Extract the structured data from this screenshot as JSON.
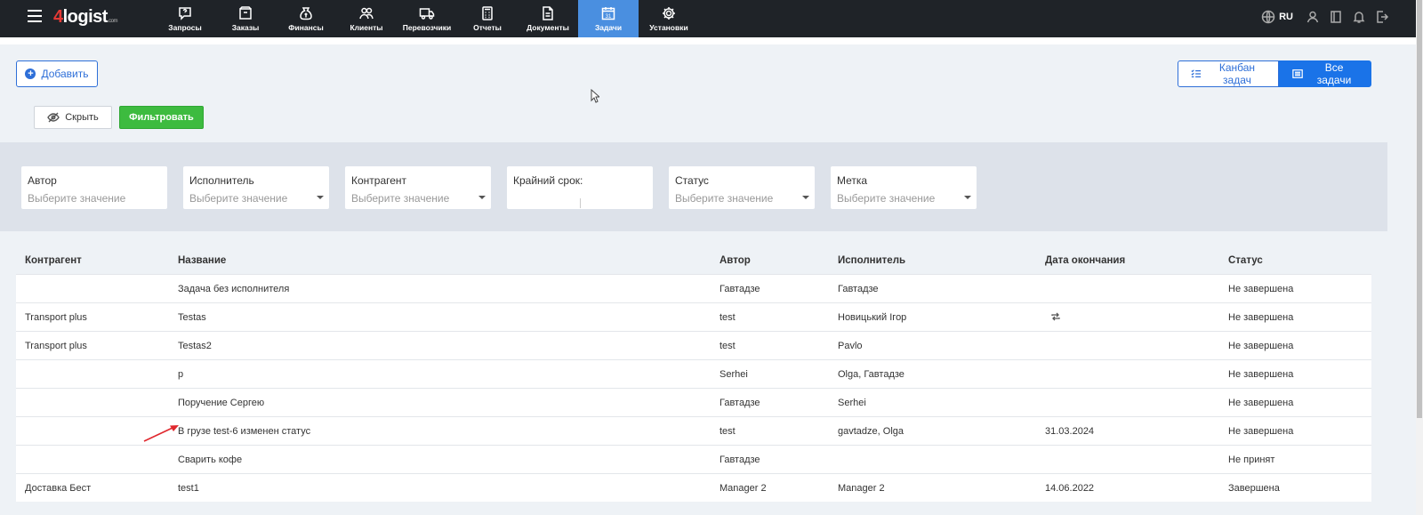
{
  "app": {
    "logo_main": "logist",
    "logo_prefix": "4",
    "logo_suffix": ".com"
  },
  "nav": {
    "items": [
      {
        "label": "Запросы",
        "icon": "question-bubble-icon"
      },
      {
        "label": "Заказы",
        "icon": "box-icon"
      },
      {
        "label": "Финансы",
        "icon": "money-bag-icon"
      },
      {
        "label": "Клиенты",
        "icon": "users-icon"
      },
      {
        "label": "Перевозчики",
        "icon": "truck-icon"
      },
      {
        "label": "Отчеты",
        "icon": "calculator-icon"
      },
      {
        "label": "Документы",
        "icon": "document-icon"
      },
      {
        "label": "Задачи",
        "icon": "calendar-icon",
        "active": true
      },
      {
        "label": "Установки",
        "icon": "gear-icon"
      }
    ],
    "lang": "RU"
  },
  "actions": {
    "add_label": "Добавить",
    "hide_label": "Скрыть",
    "filter_label": "Фильтровать",
    "kanban_label": "Канбан задач",
    "all_tasks_label": "Все задачи"
  },
  "filters": [
    {
      "label": "Автор",
      "placeholder": "Выберите значение",
      "dropdown": false
    },
    {
      "label": "Исполнитель",
      "placeholder": "Выберите значение",
      "dropdown": true
    },
    {
      "label": "Контрагент",
      "placeholder": "Выберите значение",
      "dropdown": true
    },
    {
      "label": "Крайний срок:",
      "placeholder": "",
      "dropdown": false,
      "daterange": true
    },
    {
      "label": "Статус",
      "placeholder": "Выберите значение",
      "dropdown": true
    },
    {
      "label": "Метка",
      "placeholder": "Выберите значение",
      "dropdown": true
    }
  ],
  "table": {
    "columns": [
      "Контрагент",
      "Название",
      "Автор",
      "Исполнитель",
      "Дата окончания",
      "Статус"
    ],
    "rows": [
      {
        "counterparty": "",
        "name": "Задача без исполнителя",
        "author": "Гавтадзе",
        "executor": "Гавтадзе",
        "end_date": "",
        "status": "Не завершена",
        "repeat": false
      },
      {
        "counterparty": "Transport plus",
        "name": "Testas",
        "author": "test",
        "executor": "Новицький Ігор",
        "end_date": "",
        "status": "Не завершена",
        "repeat": true
      },
      {
        "counterparty": "Transport plus",
        "name": "Testas2",
        "author": "test",
        "executor": "Pavlo",
        "end_date": "",
        "status": "Не завершена",
        "repeat": false
      },
      {
        "counterparty": "",
        "name": "p",
        "author": "Serhei",
        "executor": "Olga, Гавтадзе",
        "end_date": "",
        "status": "Не завершена",
        "repeat": false
      },
      {
        "counterparty": "",
        "name": "Поручение Сергею",
        "author": "Гавтадзе",
        "executor": "Serhei",
        "end_date": "",
        "status": "Не завершена",
        "repeat": false
      },
      {
        "counterparty": "",
        "name": "В грузе test-6 изменен статус",
        "author": "test",
        "executor": "gavtadze, Olga",
        "end_date": "31.03.2024",
        "status": "Не завершена",
        "repeat": false
      },
      {
        "counterparty": "",
        "name": "Сварить кофе",
        "author": "Гавтадзе",
        "executor": "",
        "end_date": "",
        "status": "Не принят",
        "repeat": false
      },
      {
        "counterparty": "Доставка Бест",
        "name": "test1",
        "author": "Manager 2",
        "executor": "Manager 2",
        "end_date": "14.06.2022",
        "status": "Завершена",
        "repeat": false
      }
    ]
  },
  "colors": {
    "accent": "#1a73e8",
    "filter_button": "#3dbb3f",
    "annotation_arrow": "#e0282e"
  }
}
